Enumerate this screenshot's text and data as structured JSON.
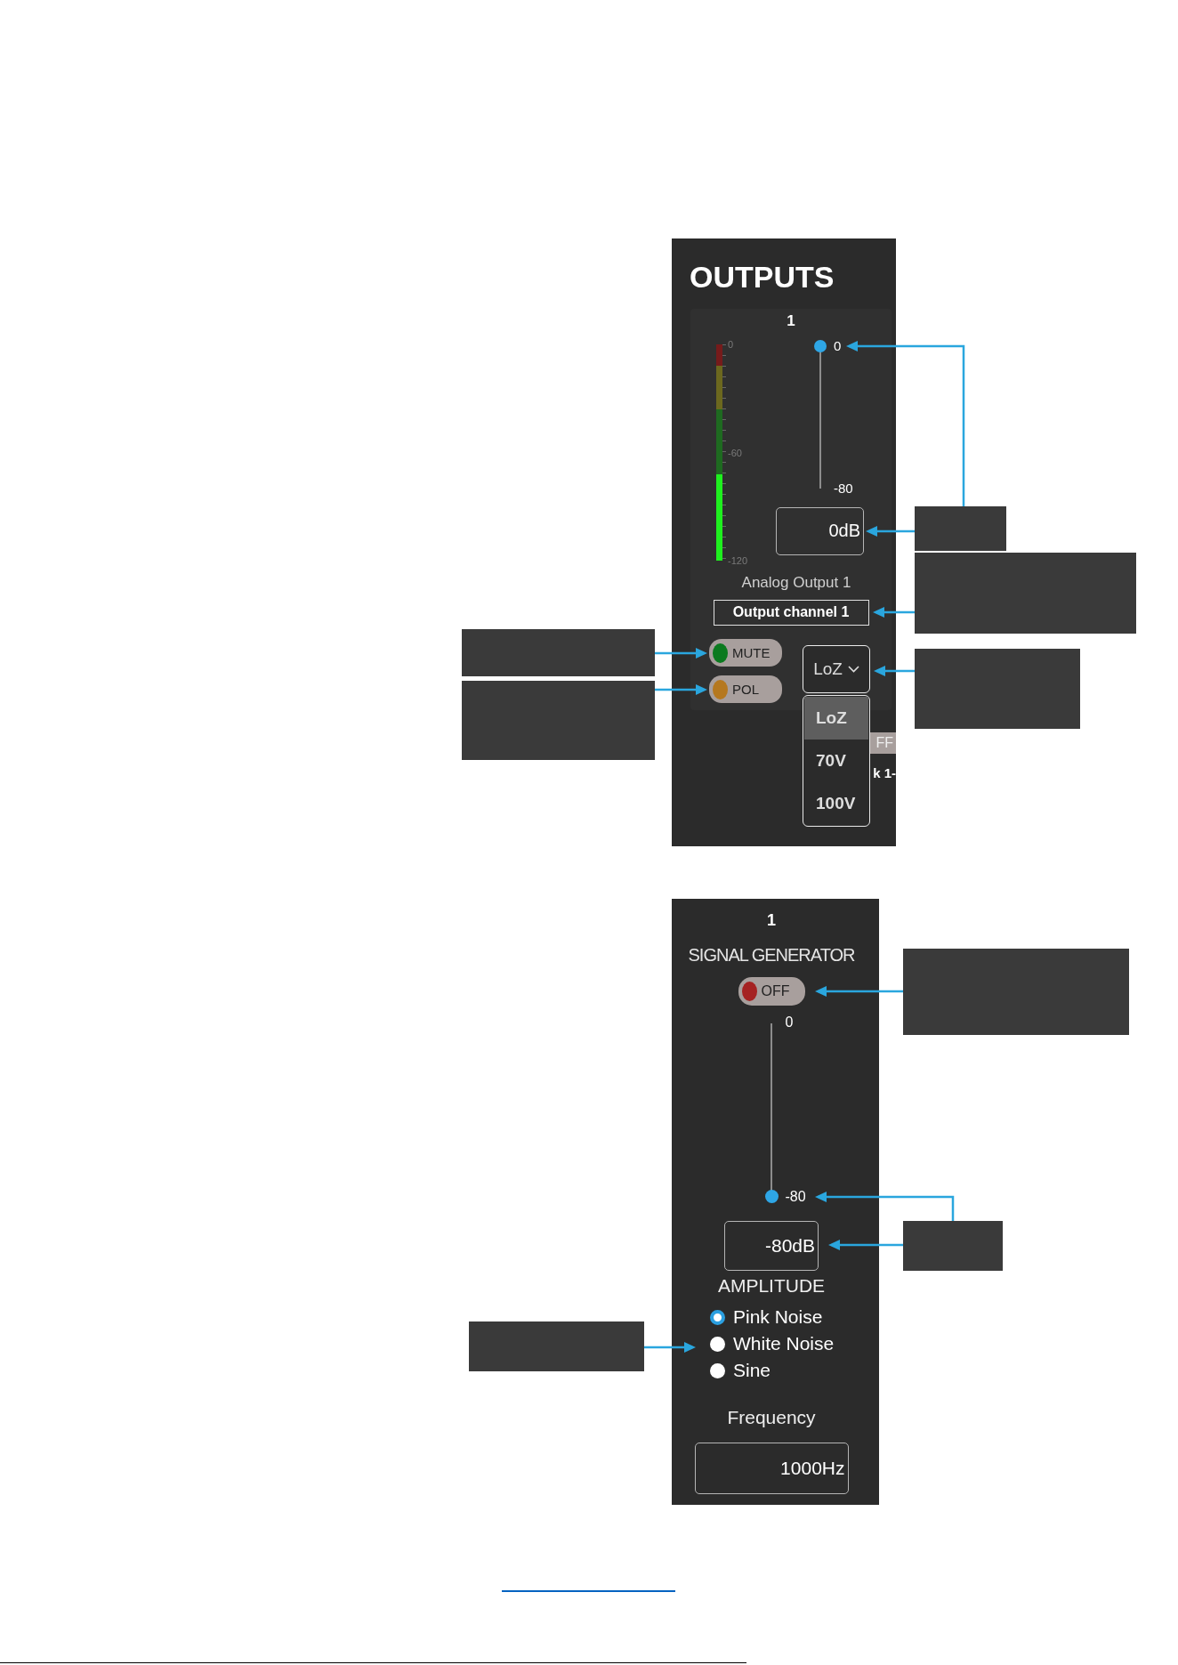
{
  "outputs_panel": {
    "title": "OUTPUTS",
    "channel": {
      "number": "1",
      "meter": {
        "level": 0.4,
        "scale": [
          "0",
          "-60",
          "-120"
        ]
      },
      "fader": {
        "level": 1,
        "labels": [
          "0",
          "-80"
        ]
      },
      "gain": "0dB",
      "name": "Analog Output 1",
      "label_field": "Output channel 1",
      "buttons": [
        {
          "label": "MUTE",
          "color": "#0b7a1f"
        },
        {
          "label": "POL",
          "color": "#b5781f"
        }
      ],
      "impedance": {
        "value": "LoZ",
        "expanded": true,
        "options": [
          {
            "label": "LoZ",
            "selected": true
          },
          {
            "label": "70V",
            "selected": false
          },
          {
            "label": "100V",
            "selected": false
          }
        ]
      }
    },
    "partly_covered": [
      {
        "kind": "button",
        "text": "FF"
      },
      {
        "kind": "label",
        "text": "k 1-"
      }
    ]
  },
  "signal_generator_panel": {
    "number": "1",
    "title": "SIGNAL GENERATOR",
    "toggle": {
      "label": "OFF",
      "on": false
    },
    "fader": {
      "level": 0,
      "labels": [
        "0",
        "-80"
      ]
    },
    "amplitude": "-80dB",
    "amplitude_label": "AMPLITUDE",
    "waveforms": [
      {
        "label": "Pink Noise",
        "selected": true
      },
      {
        "label": "White Noise",
        "selected": false
      },
      {
        "label": "Sine",
        "selected": false
      }
    ],
    "frequency_label": "Frequency",
    "frequency": "1000Hz"
  }
}
